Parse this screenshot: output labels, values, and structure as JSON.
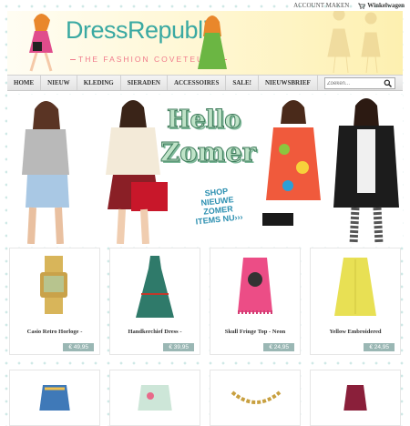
{
  "topbar": {
    "account": "ACCOUNT MAKEN",
    "cart": "Winkelwagen"
  },
  "brand": {
    "name": "DressRepublic",
    "tagline": "THE FASHION COVETEURS",
    "accent": "#3aa9a2"
  },
  "nav": {
    "items": [
      "HOME",
      "NIEUW",
      "KLEDING",
      "SIERADEN",
      "ACCESSOIRES",
      "SALE!",
      "NIEUWSBRIEF"
    ],
    "search_placeholder": "Zoeken..."
  },
  "hero": {
    "line1": "Hello",
    "line2": "Zomer",
    "shop": "SHOP NIEUWE ZOMER ITEMS NU›››"
  },
  "products": [
    {
      "title": "Casio Retro Horloge -",
      "price": "€ 49,95"
    },
    {
      "title": "Handkerchief Dress -",
      "price": "€ 39,95"
    },
    {
      "title": "Skull Fringe Top - Neon",
      "price": "€ 24,95"
    },
    {
      "title": "Yellow Embroidered",
      "price": "€ 24,95"
    }
  ]
}
